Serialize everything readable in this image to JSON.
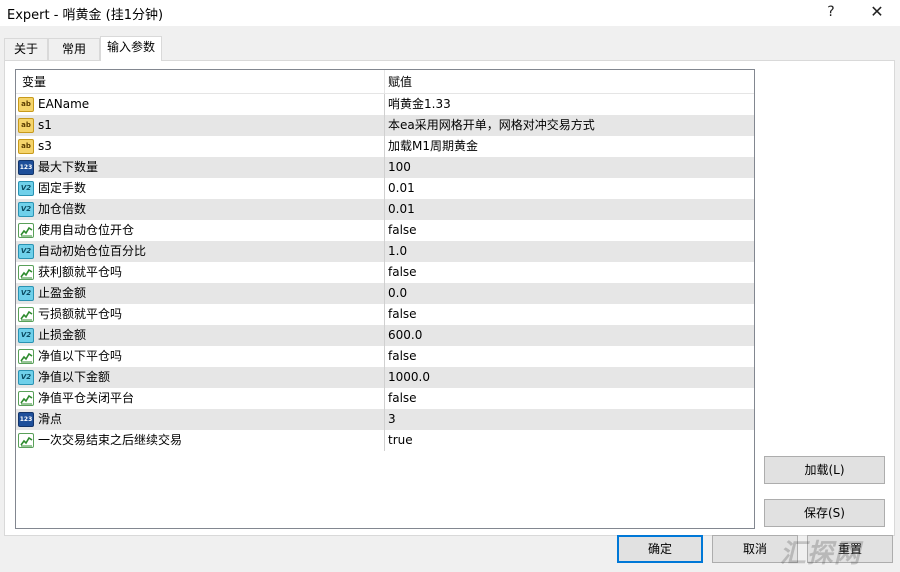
{
  "window": {
    "title": "Expert - 哨黄金 (挂1分钟)",
    "help_label": "?",
    "close_label": "✕"
  },
  "tabs": [
    {
      "label": "关于"
    },
    {
      "label": "常用"
    },
    {
      "label": "输入参数",
      "active": true
    }
  ],
  "grid": {
    "headers": {
      "variable": "变量",
      "value": "赋值"
    },
    "rows": [
      {
        "type_icon": "string-icon",
        "name": "EAName",
        "value": "哨黄金1.33"
      },
      {
        "type_icon": "string-icon",
        "name": "s1",
        "value": "本ea采用网格开单，网格对冲交易方式"
      },
      {
        "type_icon": "string-icon",
        "name": "s3",
        "value": "加载M1周期黄金"
      },
      {
        "type_icon": "integer-icon",
        "name": "最大下数量",
        "value": "100"
      },
      {
        "type_icon": "double-icon",
        "name": "固定手数",
        "value": "0.01"
      },
      {
        "type_icon": "double-icon",
        "name": "加仓倍数",
        "value": "0.01"
      },
      {
        "type_icon": "bool-icon",
        "name": "使用自动仓位开仓",
        "value": "false"
      },
      {
        "type_icon": "double-icon",
        "name": "自动初始仓位百分比",
        "value": "1.0"
      },
      {
        "type_icon": "bool-icon",
        "name": "获利额就平仓吗",
        "value": "false"
      },
      {
        "type_icon": "double-icon",
        "name": "止盈金额",
        "value": "0.0"
      },
      {
        "type_icon": "bool-icon",
        "name": "亏损额就平仓吗",
        "value": "false"
      },
      {
        "type_icon": "double-icon",
        "name": "止损金额",
        "value": "600.0"
      },
      {
        "type_icon": "bool-icon",
        "name": "净值以下平仓吗",
        "value": "false"
      },
      {
        "type_icon": "double-icon",
        "name": "净值以下金额",
        "value": "1000.0"
      },
      {
        "type_icon": "bool-icon",
        "name": "净值平仓关闭平台",
        "value": "false"
      },
      {
        "type_icon": "integer-icon",
        "name": "滑点",
        "value": "3"
      },
      {
        "type_icon": "bool-icon",
        "name": "一次交易结束之后继续交易",
        "value": "true"
      }
    ]
  },
  "buttons": {
    "load": "加载(L)",
    "save": "保存(S)",
    "ok": "确定",
    "cancel": "取消",
    "reset": "重置"
  },
  "watermark": "汇探网"
}
